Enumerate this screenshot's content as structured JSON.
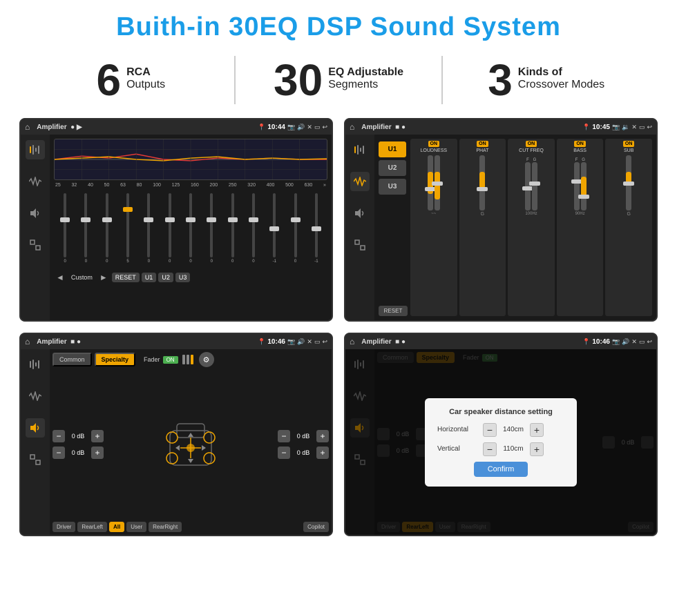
{
  "header": {
    "title": "Buith-in 30EQ DSP Sound System"
  },
  "stats": [
    {
      "number": "6",
      "line1": "RCA",
      "line2": "Outputs"
    },
    {
      "number": "30",
      "line1": "EQ Adjustable",
      "line2": "Segments"
    },
    {
      "number": "3",
      "line1": "Kinds of",
      "line2": "Crossover Modes"
    }
  ],
  "screens": [
    {
      "id": "screen1",
      "status": {
        "app": "Amplifier",
        "time": "10:44"
      },
      "eq_freqs": [
        "25",
        "32",
        "40",
        "50",
        "63",
        "80",
        "100",
        "125",
        "160",
        "200",
        "250",
        "320",
        "400",
        "500",
        "630"
      ],
      "eq_values": [
        "0",
        "0",
        "0",
        "5",
        "0",
        "0",
        "0",
        "0",
        "0",
        "0",
        "-1",
        "0",
        "-1"
      ],
      "presets": [
        "Custom",
        "RESET",
        "U1",
        "U2",
        "U3"
      ]
    },
    {
      "id": "screen2",
      "status": {
        "app": "Amplifier",
        "time": "10:45"
      },
      "presets": [
        "U1",
        "U2",
        "U3"
      ],
      "bands": [
        {
          "name": "LOUDNESS",
          "on": true
        },
        {
          "name": "PHAT",
          "on": true
        },
        {
          "name": "CUT FREQ",
          "on": true
        },
        {
          "name": "BASS",
          "on": true
        },
        {
          "name": "SUB",
          "on": true
        }
      ],
      "reset_label": "RESET"
    },
    {
      "id": "screen3",
      "status": {
        "app": "Amplifier",
        "time": "10:46"
      },
      "tabs": [
        "Common",
        "Specialty"
      ],
      "fader_label": "Fader",
      "fader_on": "ON",
      "volumes": [
        "0 dB",
        "0 dB",
        "0 dB",
        "0 dB"
      ],
      "bottom_buttons": [
        "Driver",
        "RearLeft",
        "All",
        "User",
        "RearRight",
        "Copilot"
      ]
    },
    {
      "id": "screen4",
      "status": {
        "app": "Amplifier",
        "time": "10:46"
      },
      "tabs": [
        "Common",
        "Specialty"
      ],
      "dialog": {
        "title": "Car speaker distance setting",
        "horizontal_label": "Horizontal",
        "horizontal_value": "140cm",
        "vertical_label": "Vertical",
        "vertical_value": "110cm",
        "confirm_label": "Confirm",
        "db_values": [
          "0 dB",
          "0 dB"
        ]
      }
    }
  ]
}
